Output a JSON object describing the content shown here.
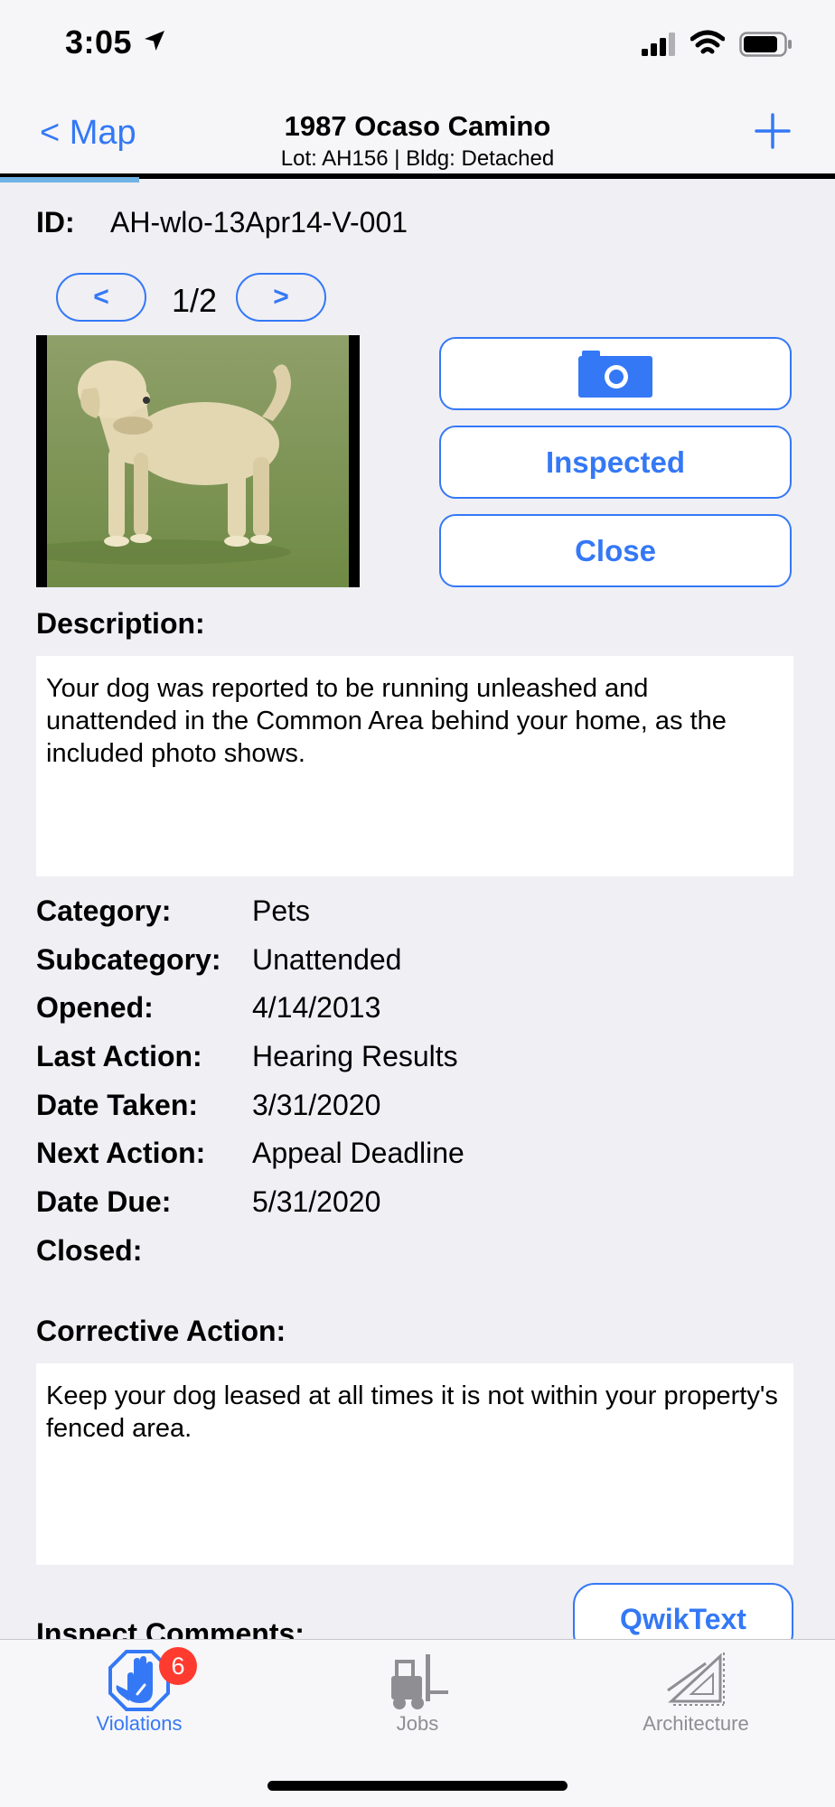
{
  "status_bar": {
    "time": "3:05"
  },
  "nav": {
    "back_label": "< Map",
    "title": "1987 Ocaso Camino",
    "subtitle": "Lot: AH156 | Bldg: Detached"
  },
  "violation": {
    "id_label": "ID:",
    "id_value": "AH-wlo-13Apr14-V-001",
    "pager": {
      "prev": "<",
      "next": ">",
      "count": "1/2"
    }
  },
  "actions": {
    "inspected": "Inspected",
    "close": "Close"
  },
  "description": {
    "label": "Description:",
    "text": "Your dog was reported to be running unleashed and unattended in the Common Area behind your home, as the included photo shows."
  },
  "fields": [
    {
      "label": "Category:",
      "value": "Pets"
    },
    {
      "label": "Subcategory:",
      "value": "Unattended"
    },
    {
      "label": "Opened:",
      "value": "4/14/2013"
    },
    {
      "label": "Last Action:",
      "value": "Hearing Results"
    },
    {
      "label": "Date Taken:",
      "value": "3/31/2020"
    },
    {
      "label": "Next Action:",
      "value": "Appeal Deadline"
    },
    {
      "label": "Date Due:",
      "value": "5/31/2020"
    },
    {
      "label": "Closed:",
      "value": ""
    }
  ],
  "corrective": {
    "label": "Corrective Action:",
    "text": "Keep your dog leased at all times it is not within your property's fenced area."
  },
  "inspect": {
    "label": "Inspect Comments:",
    "qwiktext": "QwikText"
  },
  "tabs": {
    "violations": {
      "label": "Violations",
      "badge": "6"
    },
    "jobs": {
      "label": "Jobs"
    },
    "architecture": {
      "label": "Architecture"
    }
  },
  "colors": {
    "accent": "#3478f6",
    "background": "#efeff4",
    "badge": "#ff3b30"
  }
}
